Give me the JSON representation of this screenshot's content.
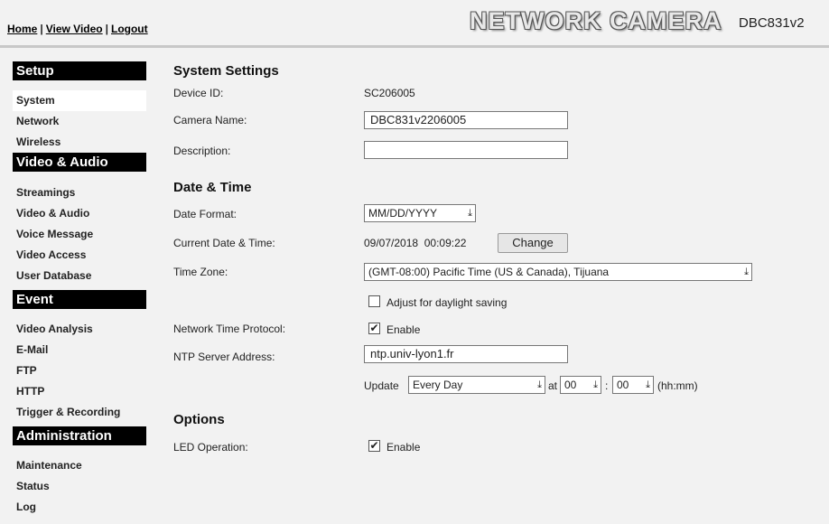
{
  "header": {
    "links": [
      "Home",
      "View Video",
      "Logout"
    ],
    "separator": "|",
    "brand": "NETWORK CAMERA",
    "model": "DBC831v2"
  },
  "sidebar": {
    "sections": [
      {
        "title": "Setup",
        "items": [
          "System",
          "Network",
          "Wireless"
        ]
      },
      {
        "title": "Video & Audio",
        "items": [
          "Streamings",
          "Video & Audio",
          "Voice Message",
          "Video Access",
          "User Database"
        ]
      },
      {
        "title": "Event",
        "items": [
          "Video Analysis",
          "E-Mail",
          "FTP",
          "HTTP",
          "Trigger & Recording"
        ]
      },
      {
        "title": "Administration",
        "items": [
          "Maintenance",
          "Status",
          "Log"
        ]
      }
    ],
    "active_item": "System"
  },
  "system_settings": {
    "heading": "System Settings",
    "device_id_label": "Device ID:",
    "device_id_value": "SC206005",
    "camera_name_label": "Camera Name:",
    "camera_name_value": "DBC831v2206005",
    "description_label": "Description:",
    "description_value": ""
  },
  "date_time": {
    "heading": "Date & Time",
    "date_format_label": "Date Format:",
    "date_format_value": "MM/DD/YYYY",
    "current_label": "Current Date & Time:",
    "current_value": "09/07/2018  00:09:22",
    "change_button": "Change",
    "timezone_label": "Time Zone:",
    "timezone_value": "(GMT-08:00) Pacific Time (US & Canada), Tijuana",
    "dst_label": "Adjust for daylight saving",
    "dst_checked": false,
    "ntp_label": "Network Time Protocol:",
    "ntp_enable_label": "Enable",
    "ntp_checked": true,
    "ntp_server_label": "NTP Server Address:",
    "ntp_server_value": "ntp.univ-lyon1.fr",
    "update_label": "Update",
    "update_value": "Every Day",
    "at_label": "at",
    "hour_value": "00",
    "colon": ":",
    "minute_value": "00",
    "hhmm_label": "(hh:mm)"
  },
  "options": {
    "heading": "Options",
    "led_label": "LED Operation:",
    "led_enable_label": "Enable",
    "led_checked": true
  },
  "icons": {
    "dropdown": "chevron-down-icon",
    "checkmark": "checkmark-icon"
  }
}
